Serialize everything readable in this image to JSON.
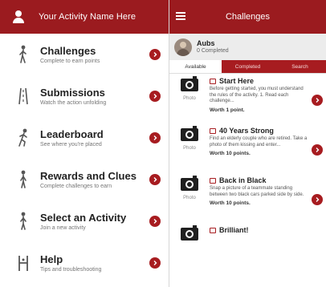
{
  "left": {
    "header_title": "Your Activity Name Here",
    "menu": [
      {
        "title": "Challenges",
        "subtitle": "Complete to earn points",
        "icon": "person-walking-icon"
      },
      {
        "title": "Submissions",
        "subtitle": "Watch the action unfolding",
        "icon": "road-icon"
      },
      {
        "title": "Leaderboard",
        "subtitle": "See where you're placed",
        "icon": "runner-icon"
      },
      {
        "title": "Rewards and Clues",
        "subtitle": "Complete challenges to earn",
        "icon": "person-walking-icon"
      },
      {
        "title": "Select an Activity",
        "subtitle": "Join a new activity",
        "icon": "person-standing-icon"
      },
      {
        "title": "Help",
        "subtitle": "Tips and troubleshooting",
        "icon": "door-icon"
      }
    ]
  },
  "right": {
    "header_title": "Challenges",
    "profile": {
      "name": "Aubs",
      "status": "0 Completed"
    },
    "tabs": [
      "Available",
      "Completed",
      "Search"
    ],
    "challenges": [
      {
        "title": "Start Here",
        "description": "Before getting started, you must understand the rules of the activity. 1. Read each challenge...",
        "worth": "Worth 1 point.",
        "photo_label": "Photo"
      },
      {
        "title": "40 Years Strong",
        "description": "Find an elderly couple who are retired. Take a photo of them kissing and enter...",
        "worth": "Worth 10 points.",
        "photo_label": "Photo"
      },
      {
        "title": "Back in Black",
        "description": "Snap a picture of a teammate standing between two black cars parked side by side.",
        "worth": "Worth 10 points.",
        "photo_label": "Photo"
      },
      {
        "title": "Brilliant!",
        "description": "",
        "worth": "",
        "photo_label": ""
      }
    ]
  },
  "colors": {
    "brand_red": "#9b1b1f",
    "accent_red": "#a71c20"
  }
}
